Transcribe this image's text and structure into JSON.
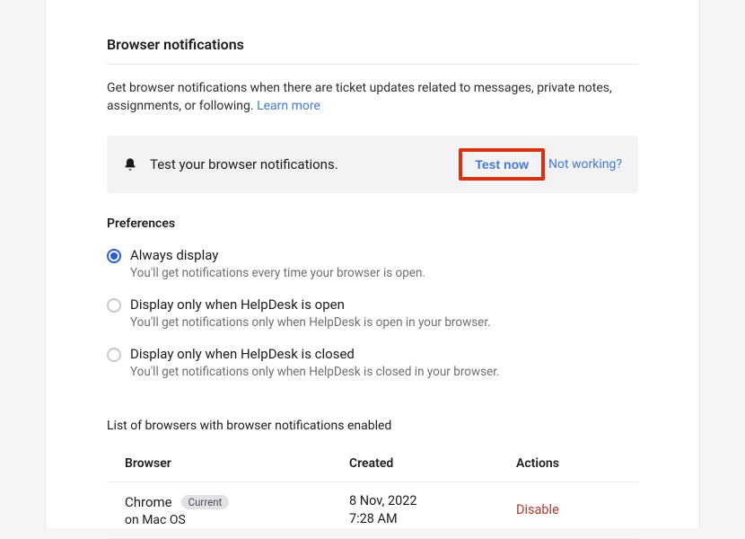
{
  "section": {
    "title": "Browser notifications",
    "description": "Get browser notifications when there are ticket updates related to messages, private notes, assignments, or following. ",
    "learn_more": "Learn more"
  },
  "test_bar": {
    "text": "Test your browser notifications.",
    "test_now": "Test now",
    "not_working": "Not working?"
  },
  "preferences": {
    "title": "Preferences",
    "options": [
      {
        "label": "Always display",
        "desc": "You'll get notifications every time your browser is open.",
        "selected": true
      },
      {
        "label": "Display only when HelpDesk is open",
        "desc": "You'll get notifications only when HelpDesk is open in your browser.",
        "selected": false
      },
      {
        "label": "Display only when HelpDesk is closed",
        "desc": "You'll get notifications only when HelpDesk is closed in your browser.",
        "selected": false
      }
    ]
  },
  "browsers": {
    "list_title": "List of browsers with browser notifications enabled",
    "columns": {
      "browser": "Browser",
      "created": "Created",
      "actions": "Actions"
    },
    "rows": [
      {
        "name": "Chrome",
        "current_badge": "Current",
        "os": "on Mac OS",
        "created_date": "8 Nov, 2022",
        "created_time": "7:28 AM",
        "action": "Disable"
      }
    ]
  }
}
